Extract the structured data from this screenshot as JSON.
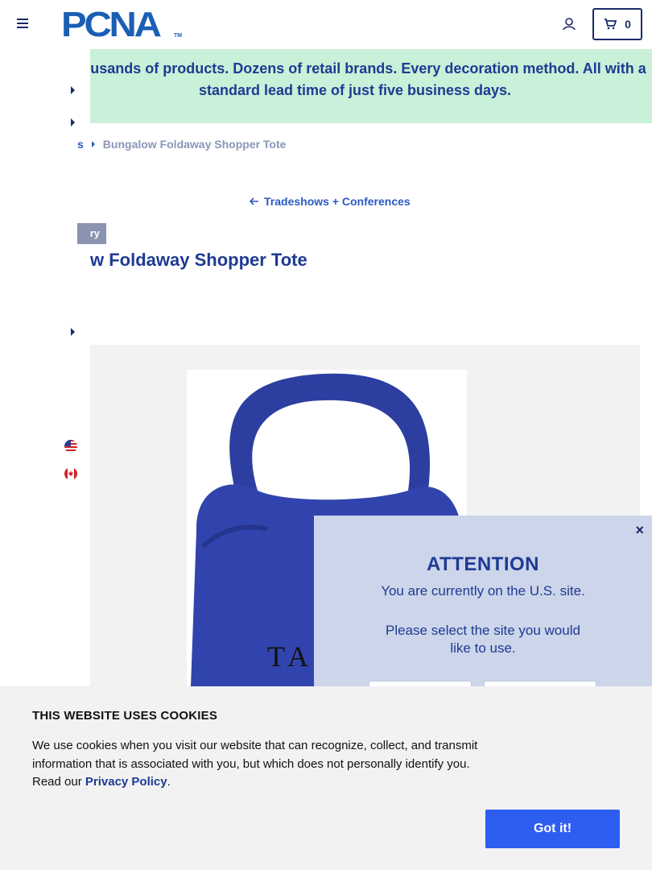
{
  "header": {
    "logo_text": "PCNA",
    "logo_tm": "TM",
    "cart_count": "0"
  },
  "banner": {
    "text": "Thousands of products. Dozens of retail brands. Every decoration method. All with a standard lead time of just five business days."
  },
  "breadcrumb": {
    "previous": "s",
    "current": "Bungalow Foldaway Shopper Tote"
  },
  "back_link": {
    "label": "Tradeshows + Conferences"
  },
  "product": {
    "tag": "ry",
    "title": "w Foldaway Shopper Tote",
    "photo_imprint": "TA"
  },
  "modal": {
    "close": "×",
    "title": "ATTENTION",
    "body1": "You are currently on the U.S. site.",
    "body2": "Please select the site you would like to use."
  },
  "cookie": {
    "title": "THIS WEBSITE USES COOKIES",
    "text_before": "We use cookies when you visit our website that can recognize, collect, and transmit information that is associated with you, but which does not personally identify you. Read our ",
    "link": "Privacy Policy",
    "text_after": ".",
    "button": "Got it!"
  },
  "colors": {
    "brand_blue": "#1a5fb4",
    "navy": "#1f3a93",
    "banner_green": "#c9f0d8",
    "modal_bg": "#ccd5ea",
    "cookie_button": "#2d5ef0",
    "bag_blue": "#2c3fa0"
  },
  "icons": [
    "menu-icon",
    "account-icon",
    "cart-icon",
    "caret-right-icon",
    "arrow-left-icon",
    "us-flag-icon",
    "canada-flag-icon",
    "close-icon"
  ]
}
